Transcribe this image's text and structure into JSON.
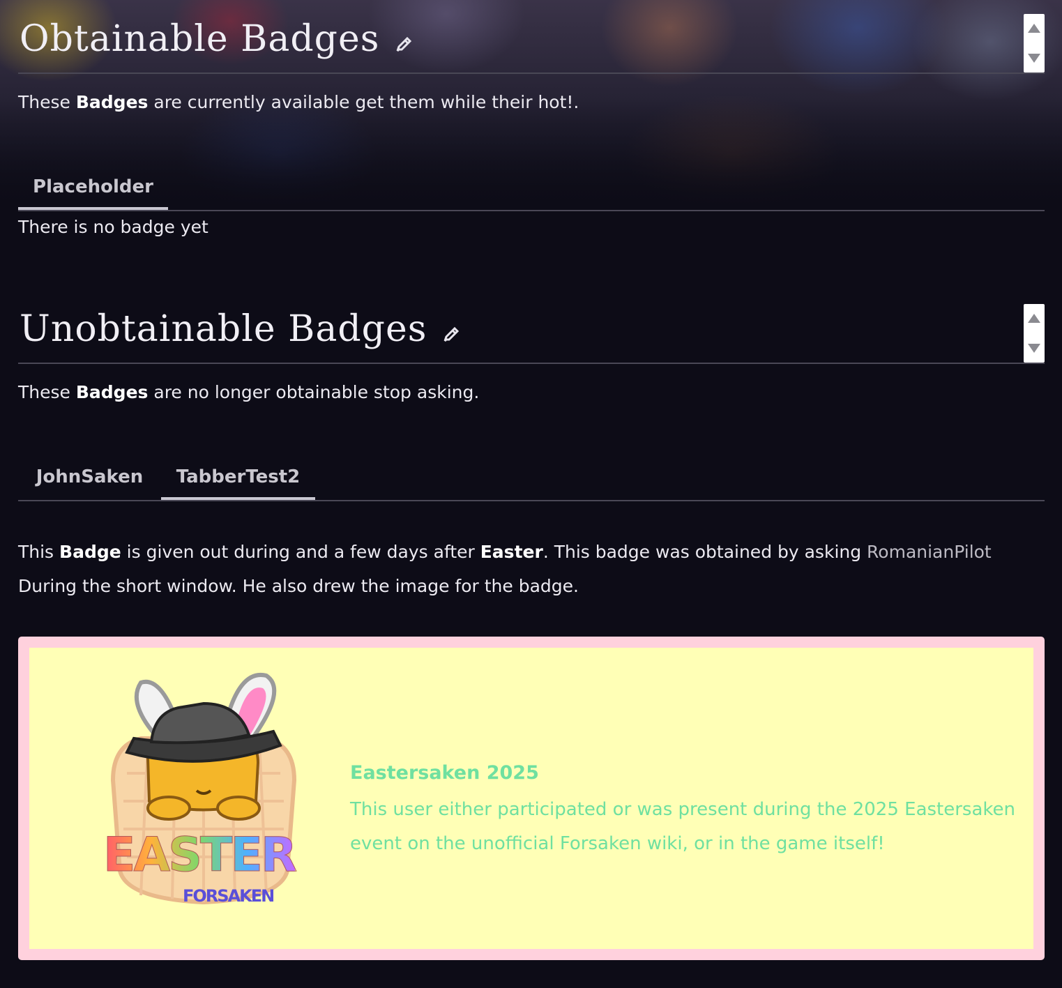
{
  "obtainable": {
    "title": "Obtainable Badges",
    "desc_prefix": "These ",
    "desc_bold": "Badges",
    "desc_suffix": " are currently available get them while their hot!.",
    "tabs": [
      "Placeholder"
    ],
    "active_tab": "Placeholder",
    "content": "There is no badge yet"
  },
  "unobtainable": {
    "title": "Unobtainable Badges",
    "desc_prefix": "These ",
    "desc_bold": "Badges",
    "desc_suffix": " are no longer obtainable stop asking.",
    "tabs": [
      "JohnSaken",
      "TabberTest2"
    ],
    "active_tab": "TabberTest2",
    "body": {
      "t1": "This ",
      "b1": "Badge",
      "t2": " is given out during and a few days after ",
      "b2": "Easter",
      "t3": ". This badge was obtained by asking ",
      "link": "RomanianPilot",
      "t4": " During the short window. He also drew the image for the badge."
    },
    "badge": {
      "name": "Eastersaken 2025",
      "description": "This user either participated or was present during the 2025 Eastersaken event on the unofficial Forsaken wiki, or in the game itself!",
      "image_text_main": "EASTER",
      "image_text_sub": "FORSAKEN",
      "border_color": "#ffd1dd",
      "background_color": "#ffffb6",
      "text_color": "#6fe0a0"
    }
  },
  "icons": {
    "edit": "pencil-icon",
    "scroll_up": "triangle-up-icon",
    "scroll_down": "triangle-down-icon"
  }
}
